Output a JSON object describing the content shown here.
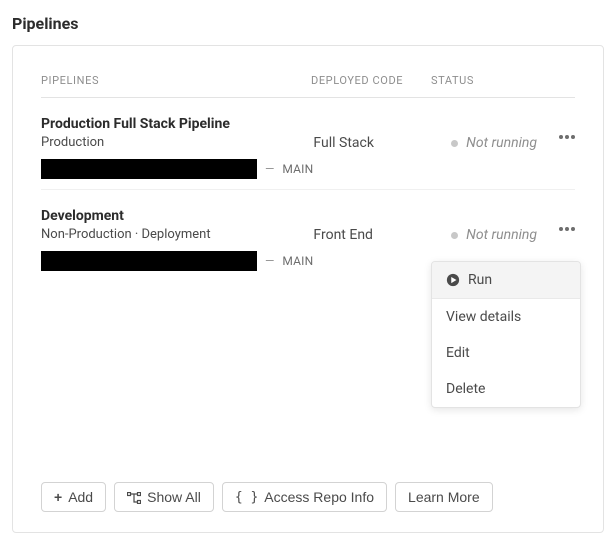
{
  "page_title": "Pipelines",
  "columns": {
    "pipelines": "PIPELINES",
    "deployed": "DEPLOYED CODE",
    "status": "STATUS"
  },
  "rows": [
    {
      "title": "Production Full Stack Pipeline",
      "sub": "Production",
      "branch": "MAIN",
      "deployed": "Full Stack",
      "status": "Not running"
    },
    {
      "title": "Development",
      "sub": "Non-Production  ·  Deployment",
      "branch": "MAIN",
      "deployed": "Front End",
      "status": "Not running"
    }
  ],
  "menu": {
    "run": "Run",
    "view": "View details",
    "edit": "Edit",
    "delete": "Delete"
  },
  "footer": {
    "add": "Add",
    "show_all": "Show All",
    "access_repo": "Access Repo Info",
    "learn_more": "Learn More"
  }
}
